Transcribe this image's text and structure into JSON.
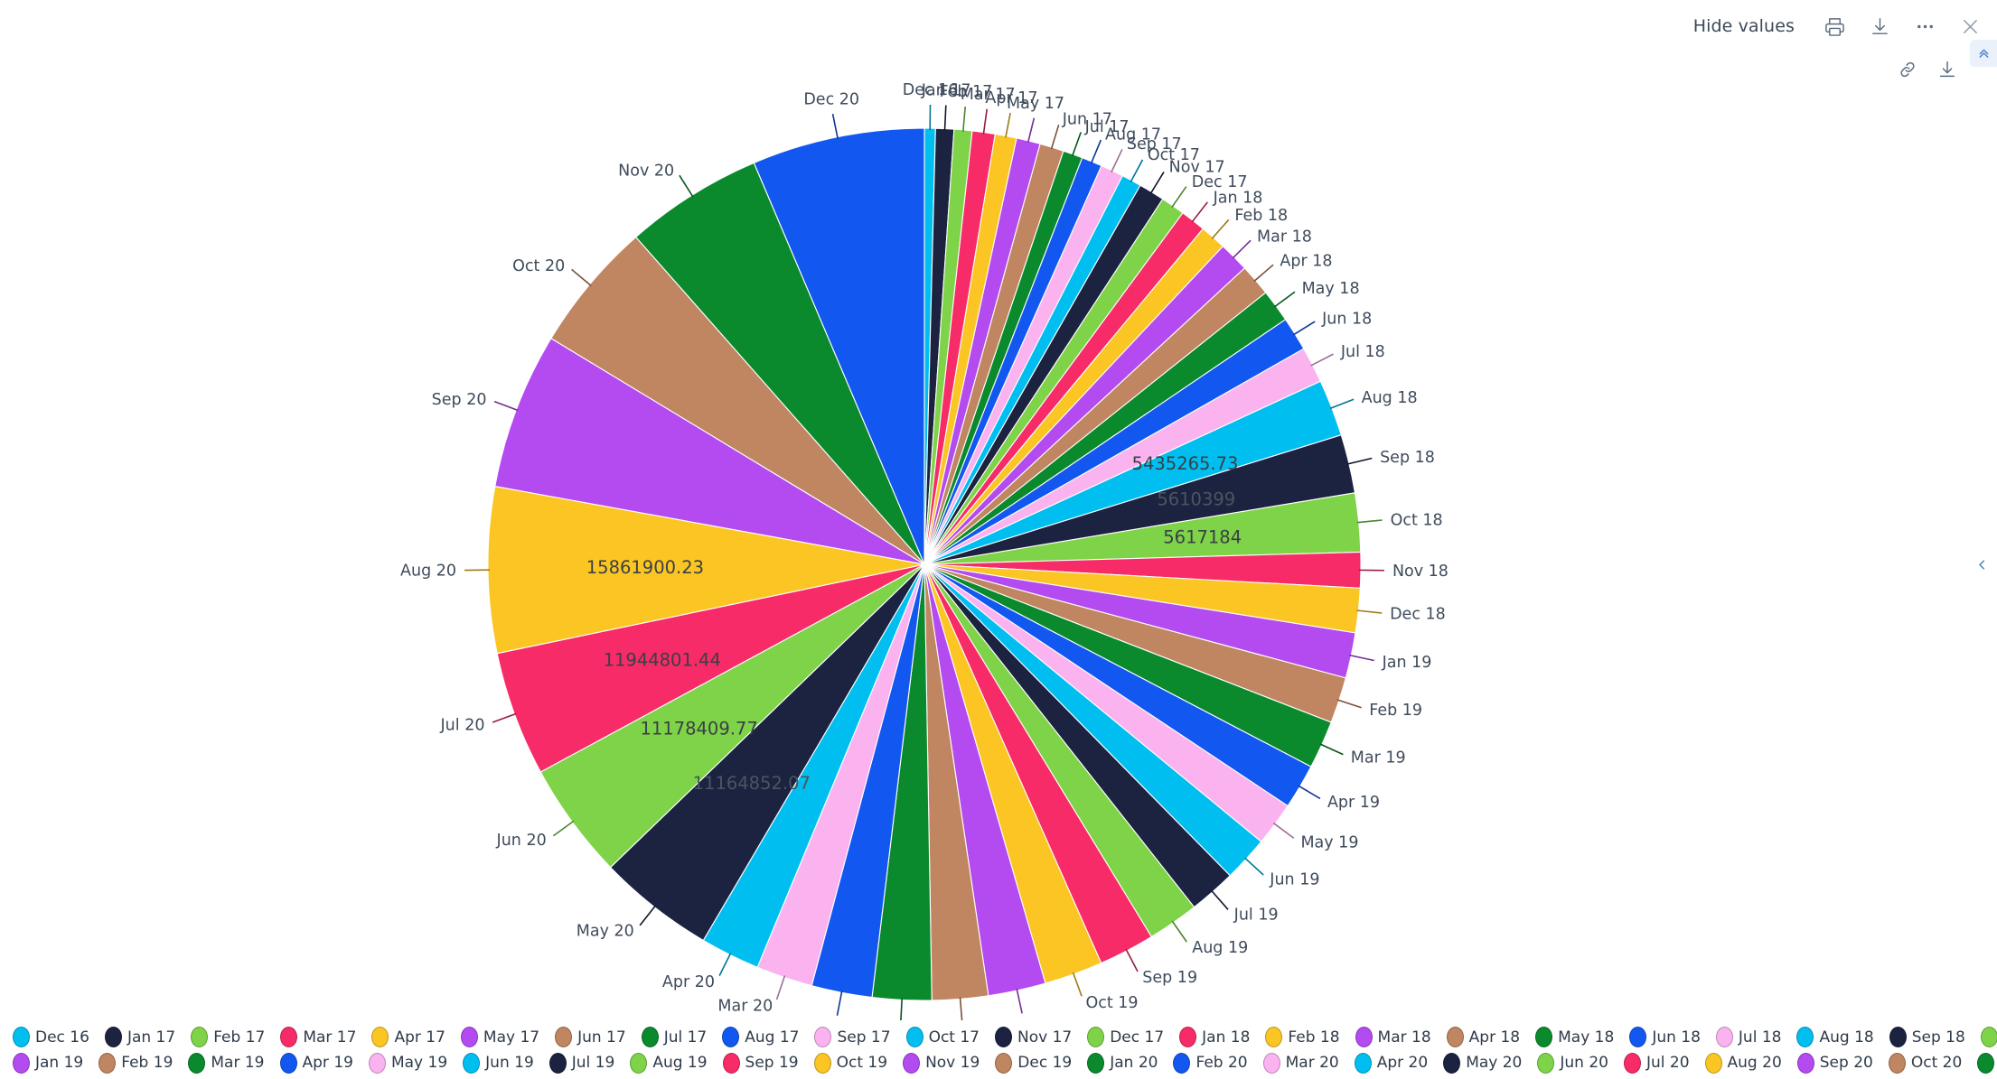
{
  "toolbar": {
    "hide_values_label": "Hide values",
    "print_icon": "printer-icon",
    "download_icon": "download-icon",
    "more_icon": "ellipsis-icon",
    "close_icon": "close-icon",
    "collapse_icon": "chevron-double-up-icon",
    "link_icon": "link-icon",
    "sub_download_icon": "download-icon",
    "right_collapse_icon": "chevron-left-icon"
  },
  "chart_data": {
    "type": "pie",
    "title": "",
    "start_angle_deg": 0,
    "direction": "clockwise",
    "labels_outside": true,
    "value_labels_shown": true,
    "legend_position": "bottom",
    "palette": [
      "#00BFF0",
      "#1B2340",
      "#7ED348",
      "#F72B67",
      "#FBC623",
      "#B44BF0",
      "#C08561",
      "#0A8A2C",
      "#1258F0",
      "#FBB3F0"
    ],
    "categories": [
      "Dec 16",
      "Jan 17",
      "Feb 17",
      "Mar 17",
      "Apr 17",
      "May 17",
      "Jun 17",
      "Jul 17",
      "Aug 17",
      "Sep 17",
      "Oct 17",
      "Nov 17",
      "Dec 17",
      "Jan 18",
      "Feb 18",
      "Mar 18",
      "Apr 18",
      "May 18",
      "Jun 18",
      "Jul 18",
      "Aug 18",
      "Sep 18",
      "Oct 18",
      "Nov 18",
      "Dec 18",
      "Jan 19",
      "Feb 19",
      "Mar 19",
      "Apr 19",
      "May 19",
      "Jun 19",
      "Jul 19",
      "Aug 19",
      "Sep 19",
      "Oct 19",
      "Nov 19",
      "Dec 19",
      "Jan 20",
      "Feb 20",
      "Mar 20",
      "Apr 20",
      "May 20",
      "Jun 20",
      "Jul 20",
      "Aug 20",
      "Sep 20",
      "Oct 20",
      "Nov 20",
      "Dec 20"
    ],
    "values": [
      1050000,
      1750000,
      1720000,
      2180000,
      2060000,
      2280000,
      2300000,
      1880000,
      1960000,
      2200000,
      1900000,
      2480000,
      2300000,
      2420000,
      2500000,
      2900000,
      3050000,
      3150000,
      3250000,
      3450000,
      5435265.73,
      5610399,
      5617184,
      3400000,
      4250000,
      4350000,
      4400000,
      4600000,
      4300000,
      4200000,
      4350000,
      4500000,
      4900000,
      5350000,
      5600000,
      5500000,
      5350000,
      5650000,
      5800000,
      5400000,
      5700000,
      11164852.07,
      11178409.77,
      11944801.44,
      15861900.23,
      15000000,
      12500000,
      13200000,
      16500000
    ],
    "annotated_values": [
      {
        "category": "Aug 20",
        "text": "15861900.23"
      },
      {
        "category": "Jul 20",
        "text": "11944801.44"
      },
      {
        "category": "Jun 20",
        "text": "11178409.77"
      },
      {
        "category": "May 20",
        "text": "11164852.07"
      },
      {
        "category": "Aug 18",
        "text": "5435265.73"
      },
      {
        "category": "Sep 18",
        "text": "5610399"
      },
      {
        "category": "Oct 18",
        "text": "5617184"
      }
    ]
  }
}
